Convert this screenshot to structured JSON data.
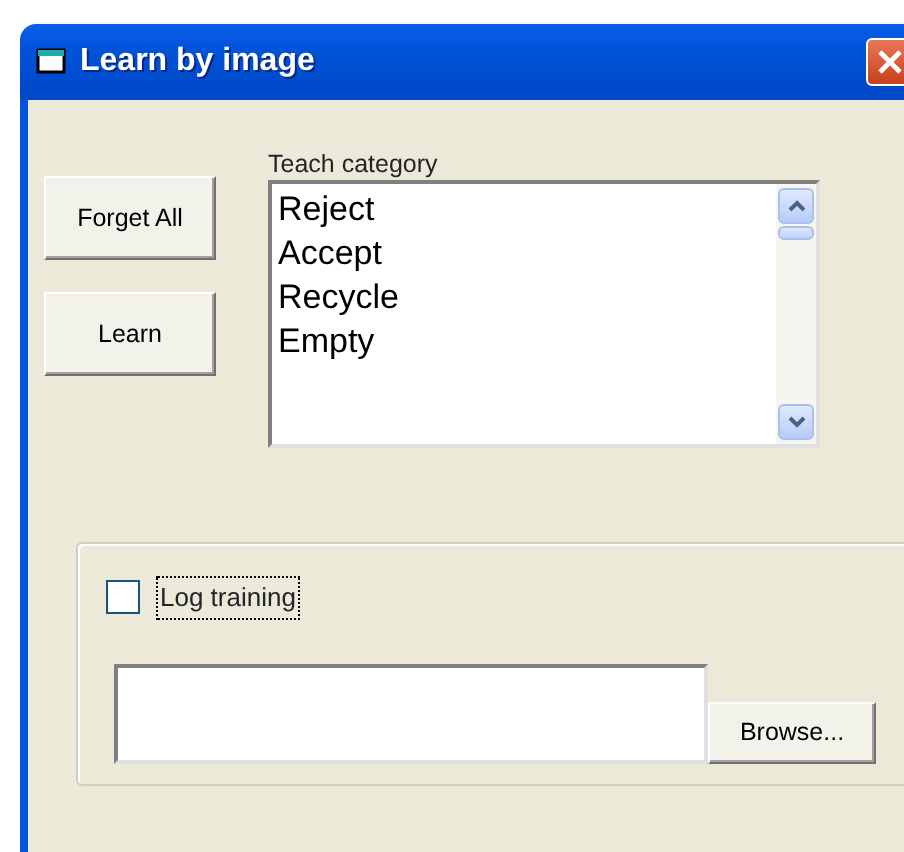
{
  "window": {
    "title": "Learn by image"
  },
  "buttons": [
    {
      "label": "Forget All"
    },
    {
      "label": "Learn"
    }
  ],
  "category_list": {
    "label": "Teach category",
    "items": [
      {
        "label": "Reject",
        "selected": false
      },
      {
        "label": "Accept",
        "selected": false
      },
      {
        "label": "Recycle",
        "selected": false
      },
      {
        "label": "Empty",
        "selected": false
      }
    ]
  },
  "log_group": {
    "checkbox": {
      "label": "Log training",
      "checked": false,
      "focused": true
    },
    "browse_button": {
      "label": "Browse..."
    }
  }
}
